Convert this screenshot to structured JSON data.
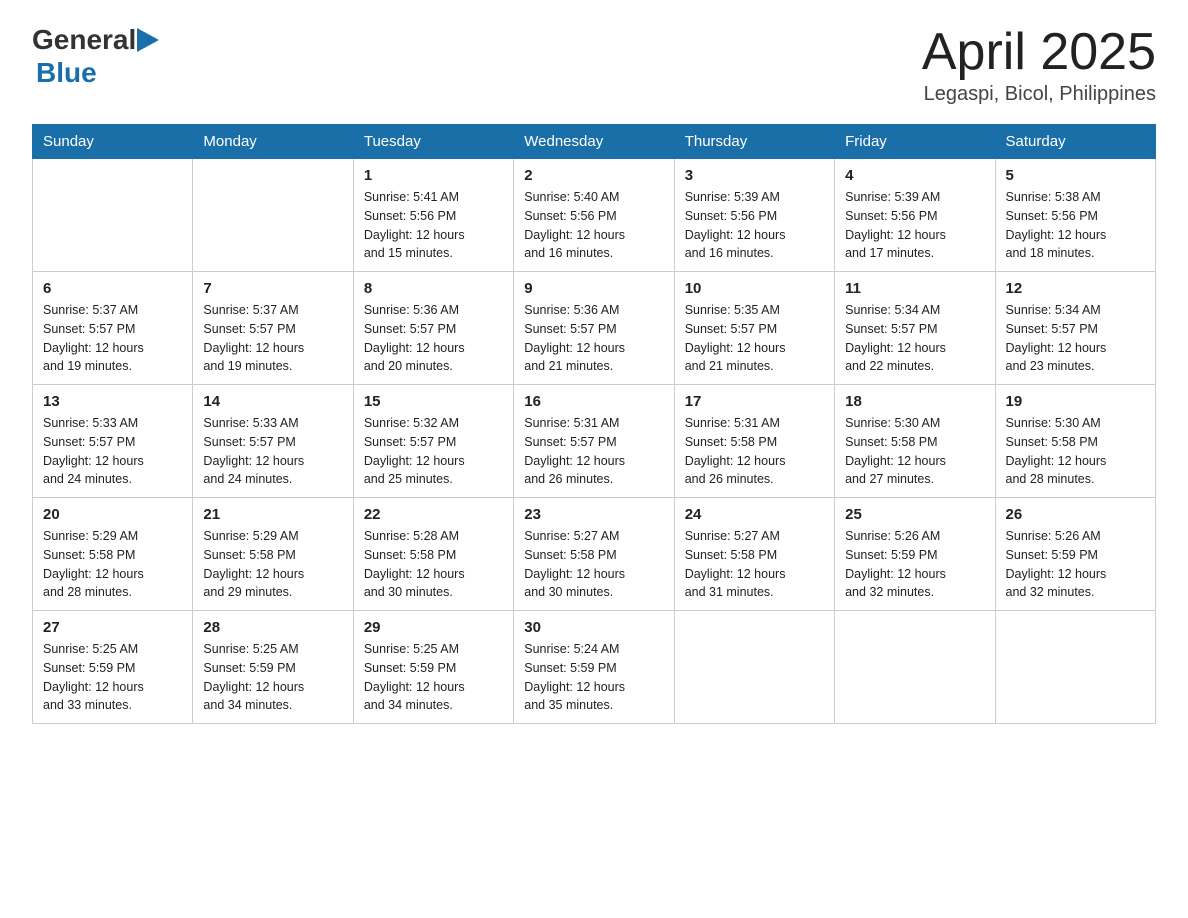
{
  "header": {
    "logo_general": "General",
    "logo_blue": "Blue",
    "month_title": "April 2025",
    "location": "Legaspi, Bicol, Philippines"
  },
  "days_of_week": [
    "Sunday",
    "Monday",
    "Tuesday",
    "Wednesday",
    "Thursday",
    "Friday",
    "Saturday"
  ],
  "weeks": [
    [
      {
        "day": "",
        "info": ""
      },
      {
        "day": "",
        "info": ""
      },
      {
        "day": "1",
        "info": "Sunrise: 5:41 AM\nSunset: 5:56 PM\nDaylight: 12 hours\nand 15 minutes."
      },
      {
        "day": "2",
        "info": "Sunrise: 5:40 AM\nSunset: 5:56 PM\nDaylight: 12 hours\nand 16 minutes."
      },
      {
        "day": "3",
        "info": "Sunrise: 5:39 AM\nSunset: 5:56 PM\nDaylight: 12 hours\nand 16 minutes."
      },
      {
        "day": "4",
        "info": "Sunrise: 5:39 AM\nSunset: 5:56 PM\nDaylight: 12 hours\nand 17 minutes."
      },
      {
        "day": "5",
        "info": "Sunrise: 5:38 AM\nSunset: 5:56 PM\nDaylight: 12 hours\nand 18 minutes."
      }
    ],
    [
      {
        "day": "6",
        "info": "Sunrise: 5:37 AM\nSunset: 5:57 PM\nDaylight: 12 hours\nand 19 minutes."
      },
      {
        "day": "7",
        "info": "Sunrise: 5:37 AM\nSunset: 5:57 PM\nDaylight: 12 hours\nand 19 minutes."
      },
      {
        "day": "8",
        "info": "Sunrise: 5:36 AM\nSunset: 5:57 PM\nDaylight: 12 hours\nand 20 minutes."
      },
      {
        "day": "9",
        "info": "Sunrise: 5:36 AM\nSunset: 5:57 PM\nDaylight: 12 hours\nand 21 minutes."
      },
      {
        "day": "10",
        "info": "Sunrise: 5:35 AM\nSunset: 5:57 PM\nDaylight: 12 hours\nand 21 minutes."
      },
      {
        "day": "11",
        "info": "Sunrise: 5:34 AM\nSunset: 5:57 PM\nDaylight: 12 hours\nand 22 minutes."
      },
      {
        "day": "12",
        "info": "Sunrise: 5:34 AM\nSunset: 5:57 PM\nDaylight: 12 hours\nand 23 minutes."
      }
    ],
    [
      {
        "day": "13",
        "info": "Sunrise: 5:33 AM\nSunset: 5:57 PM\nDaylight: 12 hours\nand 24 minutes."
      },
      {
        "day": "14",
        "info": "Sunrise: 5:33 AM\nSunset: 5:57 PM\nDaylight: 12 hours\nand 24 minutes."
      },
      {
        "day": "15",
        "info": "Sunrise: 5:32 AM\nSunset: 5:57 PM\nDaylight: 12 hours\nand 25 minutes."
      },
      {
        "day": "16",
        "info": "Sunrise: 5:31 AM\nSunset: 5:57 PM\nDaylight: 12 hours\nand 26 minutes."
      },
      {
        "day": "17",
        "info": "Sunrise: 5:31 AM\nSunset: 5:58 PM\nDaylight: 12 hours\nand 26 minutes."
      },
      {
        "day": "18",
        "info": "Sunrise: 5:30 AM\nSunset: 5:58 PM\nDaylight: 12 hours\nand 27 minutes."
      },
      {
        "day": "19",
        "info": "Sunrise: 5:30 AM\nSunset: 5:58 PM\nDaylight: 12 hours\nand 28 minutes."
      }
    ],
    [
      {
        "day": "20",
        "info": "Sunrise: 5:29 AM\nSunset: 5:58 PM\nDaylight: 12 hours\nand 28 minutes."
      },
      {
        "day": "21",
        "info": "Sunrise: 5:29 AM\nSunset: 5:58 PM\nDaylight: 12 hours\nand 29 minutes."
      },
      {
        "day": "22",
        "info": "Sunrise: 5:28 AM\nSunset: 5:58 PM\nDaylight: 12 hours\nand 30 minutes."
      },
      {
        "day": "23",
        "info": "Sunrise: 5:27 AM\nSunset: 5:58 PM\nDaylight: 12 hours\nand 30 minutes."
      },
      {
        "day": "24",
        "info": "Sunrise: 5:27 AM\nSunset: 5:58 PM\nDaylight: 12 hours\nand 31 minutes."
      },
      {
        "day": "25",
        "info": "Sunrise: 5:26 AM\nSunset: 5:59 PM\nDaylight: 12 hours\nand 32 minutes."
      },
      {
        "day": "26",
        "info": "Sunrise: 5:26 AM\nSunset: 5:59 PM\nDaylight: 12 hours\nand 32 minutes."
      }
    ],
    [
      {
        "day": "27",
        "info": "Sunrise: 5:25 AM\nSunset: 5:59 PM\nDaylight: 12 hours\nand 33 minutes."
      },
      {
        "day": "28",
        "info": "Sunrise: 5:25 AM\nSunset: 5:59 PM\nDaylight: 12 hours\nand 34 minutes."
      },
      {
        "day": "29",
        "info": "Sunrise: 5:25 AM\nSunset: 5:59 PM\nDaylight: 12 hours\nand 34 minutes."
      },
      {
        "day": "30",
        "info": "Sunrise: 5:24 AM\nSunset: 5:59 PM\nDaylight: 12 hours\nand 35 minutes."
      },
      {
        "day": "",
        "info": ""
      },
      {
        "day": "",
        "info": ""
      },
      {
        "day": "",
        "info": ""
      }
    ]
  ]
}
